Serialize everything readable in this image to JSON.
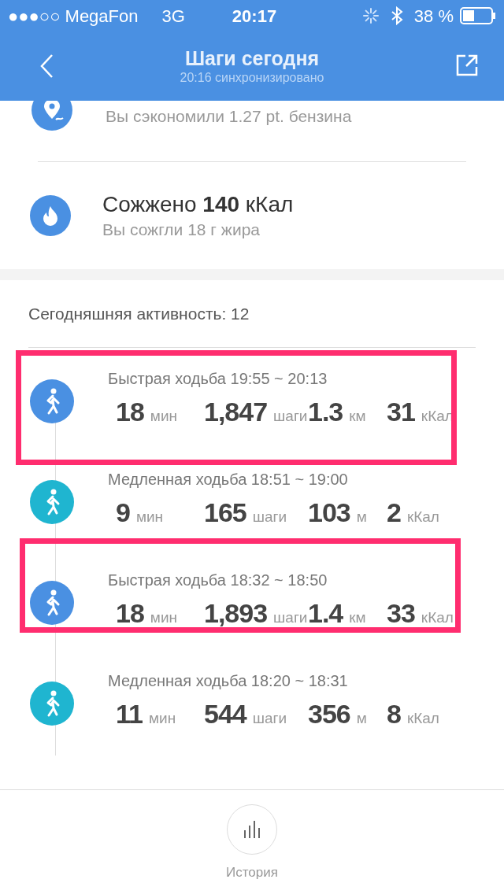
{
  "status_bar": {
    "carrier": "●●●○○ MegaFon",
    "network": "3G",
    "time": "20:17",
    "battery": "38 %"
  },
  "nav": {
    "title": "Шаги сегодня",
    "subtitle": "20:16 синхронизировано"
  },
  "stats": [
    {
      "kind": "fuel",
      "subtitle": "Вы сэкономили 1.27 pt. бензина"
    },
    {
      "kind": "fire",
      "title": "Сожжено **140** кКал",
      "subtitle": "Вы сожгли 18 г жира"
    }
  ],
  "activity_header": "Сегодняшняя активность: 12",
  "activities": [
    {
      "kind": "fast",
      "title": "Быстрая ходьба 19:55 ~ 20:13",
      "highlighted": true,
      "values": [
        {
          "value": "18",
          "unit": "мин"
        },
        {
          "value": "1,847",
          "unit": "шаги"
        },
        {
          "value": "1.3",
          "unit": "км"
        },
        {
          "value": "31",
          "unit": "кКал"
        }
      ]
    },
    {
      "kind": "slow",
      "title": "Медленная ходьба 18:51 ~ 19:00",
      "highlighted": false,
      "values": [
        {
          "value": "9",
          "unit": "мин"
        },
        {
          "value": "165",
          "unit": "шаги"
        },
        {
          "value": "103",
          "unit": "м"
        },
        {
          "value": "2",
          "unit": "кКал"
        }
      ]
    },
    {
      "kind": "fast",
      "title": "Быстрая ходьба 18:32 ~ 18:50",
      "highlighted": true,
      "values": [
        {
          "value": "18",
          "unit": "мин"
        },
        {
          "value": "1,893",
          "unit": "шаги"
        },
        {
          "value": "1.4",
          "unit": "км"
        },
        {
          "value": "33",
          "unit": "кКал"
        }
      ]
    },
    {
      "kind": "slow",
      "title": "Медленная ходьба 18:20 ~ 18:31",
      "highlighted": false,
      "values": [
        {
          "value": "11",
          "unit": "мин"
        },
        {
          "value": "544",
          "unit": "шаги"
        },
        {
          "value": "356",
          "unit": "м"
        },
        {
          "value": "8",
          "unit": "кКал"
        }
      ]
    }
  ],
  "bottom_nav": {
    "label": "История"
  }
}
